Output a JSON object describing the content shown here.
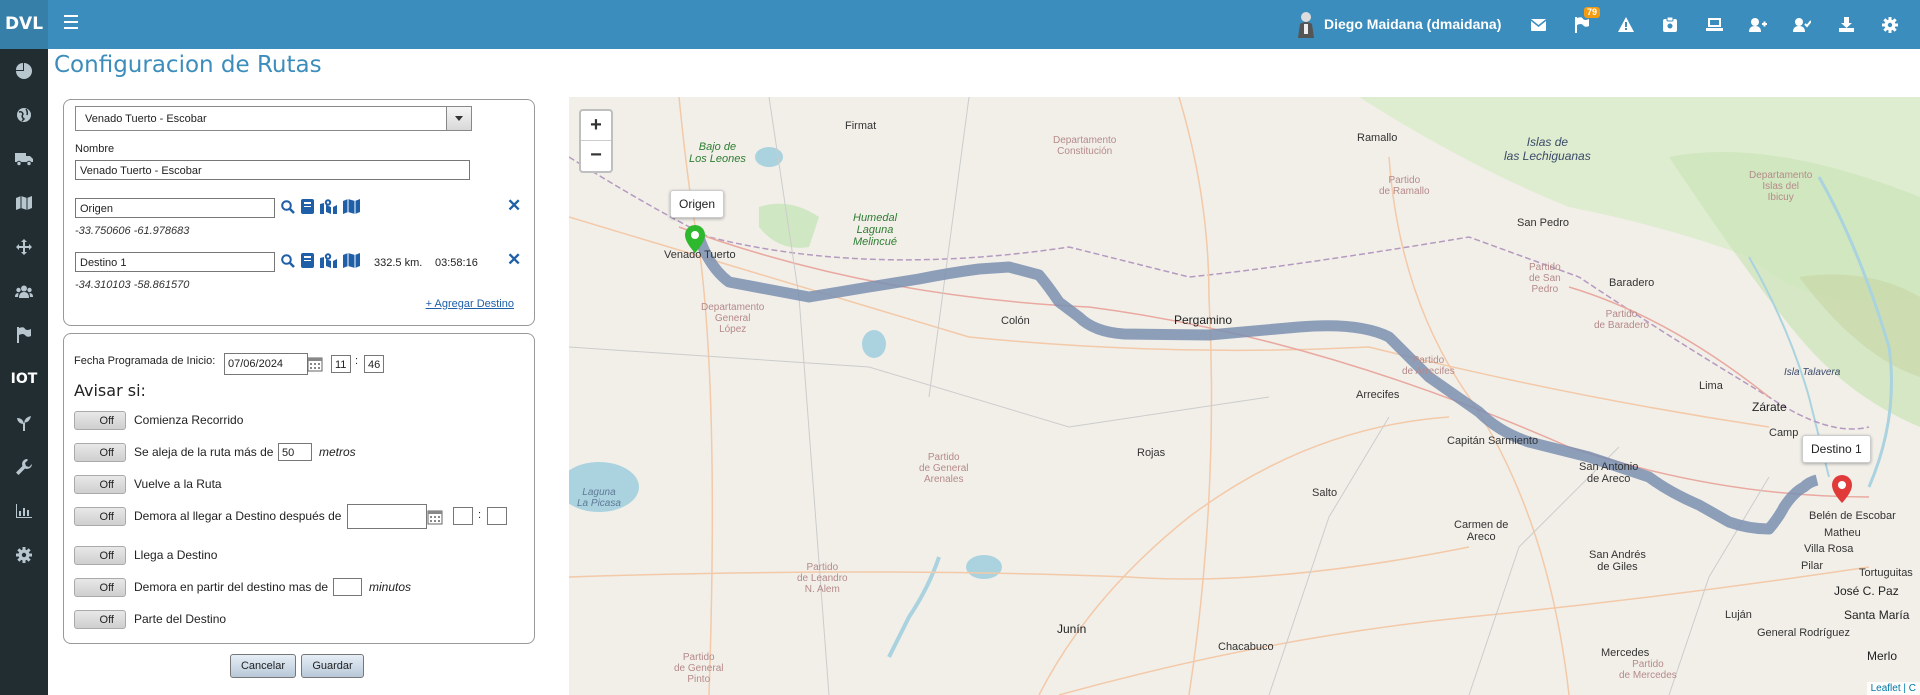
{
  "app": {
    "brand": "DVL"
  },
  "header": {
    "user_name": "Diego Maidana (dmaidana)",
    "notification_count": "79",
    "icons": [
      "envelope-icon",
      "flag-icon",
      "warning-icon",
      "clipboard-icon",
      "laptop-icon",
      "user-plus-icon",
      "user-check-icon",
      "download-icon",
      "gear-icon"
    ]
  },
  "sidebar": {
    "items": [
      "dashboard-icon",
      "globe-icon",
      "truck-icon",
      "map-icon",
      "move-icon",
      "users-icon",
      "flag-icon",
      "IOT",
      "plant-icon",
      "wrench-icon",
      "chart-icon",
      "settings-icon"
    ],
    "iot_label": "IOT"
  },
  "page": {
    "title": "Configuracion de Rutas"
  },
  "route": {
    "selected_route": "Venado Tuerto - Escobar",
    "name_label": "Nombre",
    "name_value": "Venado Tuerto - Escobar",
    "origin": {
      "value": "Origen",
      "coords": "-33.750606 -61.978683"
    },
    "destination": {
      "value": "Destino 1",
      "coords": "-34.310103 -58.861570",
      "distance": "332.5 km.",
      "duration": "03:58:16"
    },
    "add_destination": "+ Agregar Destino"
  },
  "schedule": {
    "label": "Fecha Programada de Inicio:",
    "date": "07/06/2024",
    "hour": "11",
    "minute": "46",
    "separator": ":"
  },
  "alerts": {
    "heading": "Avisar si:",
    "toggle_label": "Off",
    "items": [
      {
        "label": "Comienza Recorrido"
      },
      {
        "label": "Se aleja de la ruta más de",
        "value": "50",
        "unit": "metros"
      },
      {
        "label": "Vuelve a la Ruta"
      },
      {
        "label": "Demora al llegar a Destino después de"
      },
      {
        "label": "Llega a Destino"
      },
      {
        "label": "Demora en partir del destino mas de",
        "unit": "minutos"
      },
      {
        "label": "Parte del Destino"
      }
    ]
  },
  "buttons": {
    "cancel": "Cancelar",
    "save": "Guardar"
  },
  "map": {
    "zoom_in": "+",
    "zoom_out": "−",
    "origin_tip": "Origen",
    "dest_tip": "Destino 1",
    "attribution": "Leaflet | C",
    "labels": {
      "firmat": "Firmat",
      "ramallo": "Ramallo",
      "lechiguanas": "Islas de\nlas Lechiguanas",
      "bajo_leones": "Bajo de\nLos Leones",
      "constitucion": "Departamento\nConstitución",
      "dep_ramallo": "Partido\nde Ramallo",
      "humedal": "Humedal\nLaguna\nMelincué",
      "san_pedro": "San Pedro",
      "baradero": "Baradero",
      "venado": "Venado Tuerto",
      "dep_general_lopez": "Departamento\nGeneral\nLópez",
      "colon": "Colón",
      "pergamino": "Pergamino",
      "partido_san_pedro": "Partido\nde San\nPedro",
      "partido_baradero": "Partido\nde Baradero",
      "islas_ibicuy": "Departamento\nIslas del\nIbicuy",
      "isla_talavera": "Isla Talavera",
      "lima": "Lima",
      "zarate": "Zárate",
      "arrecifes": "Arrecifes",
      "partido_arrecifes": "Partido\nde Arrecifes",
      "capitan_sarmiento": "Capitán Sarmiento",
      "san_antonio": "San Antonio\nde Areco",
      "rojas": "Rojas",
      "partido_arenales": "Partido\nde General\nArenales",
      "salto": "Salto",
      "carmen_areco": "Carmen de\nAreco",
      "la_picasa": "Laguna\nLa Picasa",
      "san_andres": "San Andrés\nde Giles",
      "belen": "Belén de Escobar",
      "matheu": "Matheu",
      "villa_rosa": "Villa Rosa",
      "pilar": "Pilar",
      "tortuguitas": "Tortuguitas",
      "jose_paz": "José C. Paz",
      "santa_maria": "Santa María",
      "lujan": "Luján",
      "general_rodriguez": "General Rodríguez",
      "merlo": "Merlo",
      "partido_alem": "Partido\nde Leandro\nN. Alem",
      "junin": "Junín",
      "chacabuco": "Chacabuco",
      "mercedes": "Mercedes",
      "partido_mercedes": "Partido\nde Mercedes",
      "general_pinto": "Partido\nde General\nPinto",
      "campana": "Camp"
    }
  }
}
